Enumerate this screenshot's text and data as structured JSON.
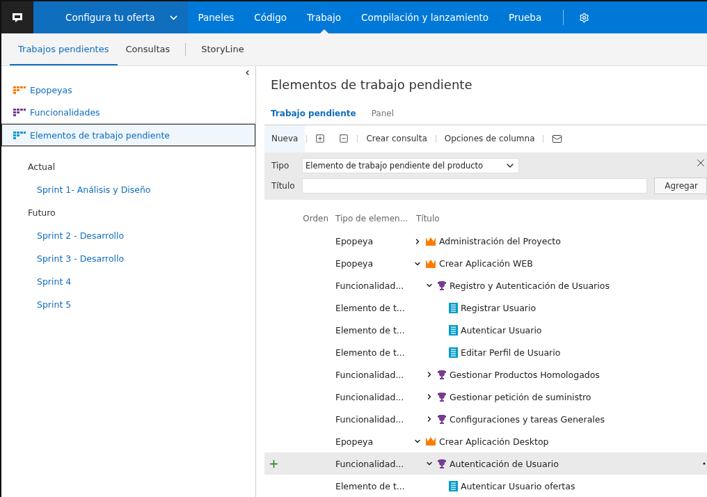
{
  "top_nav": {
    "project": "Configura tu oferta",
    "items": [
      {
        "label": "Paneles",
        "selected": false
      },
      {
        "label": "Código",
        "selected": false
      },
      {
        "label": "Trabajo",
        "selected": true
      },
      {
        "label": "Compilación y lanzamiento",
        "selected": false
      },
      {
        "label": "Prueba",
        "selected": false
      }
    ]
  },
  "sub_nav": {
    "tabs": [
      {
        "label": "Trabajos pendientes",
        "selected": true
      },
      {
        "label": "Consultas",
        "selected": false
      }
    ],
    "extra": "StoryLine"
  },
  "sidebar": {
    "levels": [
      {
        "label": "Epopeyas",
        "color": "#ff7b00",
        "selected": false
      },
      {
        "label": "Funcionalidades",
        "color": "#773b93",
        "selected": false
      },
      {
        "label": "Elementos de trabajo pendiente",
        "color": "#009ccc",
        "selected": true
      }
    ],
    "groups": [
      {
        "label": "Actual",
        "sprints": [
          "Sprint 1- Análisis y Diseño"
        ]
      },
      {
        "label": "Futuro",
        "sprints": [
          "Sprint 2 - Desarrollo",
          "Sprint 3 - Desarrollo",
          "Sprint 4",
          "Sprint 5"
        ]
      }
    ]
  },
  "main": {
    "title": "Elementos de trabajo pendiente",
    "pivots": [
      {
        "label": "Trabajo pendiente",
        "selected": true
      },
      {
        "label": "Panel",
        "selected": false
      }
    ],
    "toolbar": {
      "new": "Nueva",
      "create_query": "Crear consulta",
      "column_options": "Opciones de columna"
    },
    "add_panel": {
      "type_label": "Tipo",
      "type_value": "Elemento de trabajo pendiente del producto",
      "title_label": "Título",
      "add_button": "Agregar"
    },
    "columns": [
      "Orden",
      "Tipo de elemen...",
      "Título"
    ],
    "rows": [
      {
        "type": "Epopeya",
        "kind": "epic",
        "title": "Administración del Proyecto",
        "expanded": false,
        "selected": false
      },
      {
        "type": "Epopeya",
        "kind": "epic",
        "title": "Crear Aplicación WEB",
        "expanded": true,
        "selected": false,
        "children": [
          {
            "type": "Funcionalidad...",
            "kind": "feature",
            "title": "Registro y Autenticación de Usuarios",
            "expanded": true,
            "selected": false,
            "children": [
              {
                "type": "Elemento de t...",
                "kind": "pbi",
                "title": "Registrar Usuario",
                "selected": false
              },
              {
                "type": "Elemento de t...",
                "kind": "pbi",
                "title": "Autenticar Usuario",
                "selected": false
              },
              {
                "type": "Elemento de t...",
                "kind": "pbi",
                "title": "Editar Perfil de Usuario",
                "selected": false
              }
            ]
          },
          {
            "type": "Funcionalidad...",
            "kind": "feature",
            "title": "Gestionar Productos Homologados",
            "expanded": false,
            "selected": false
          },
          {
            "type": "Funcionalidad...",
            "kind": "feature",
            "title": "Gestionar petición de suministro",
            "expanded": false,
            "selected": false
          },
          {
            "type": "Funcionalidad...",
            "kind": "feature",
            "title": "Configuraciones y tareas Generales",
            "expanded": false,
            "selected": false
          }
        ]
      },
      {
        "type": "Epopeya",
        "kind": "epic",
        "title": "Crear Aplicación Desktop",
        "expanded": true,
        "selected": false,
        "children": [
          {
            "type": "Funcionalidad...",
            "kind": "feature",
            "title": "Autenticación de Usuario",
            "expanded": true,
            "selected": true,
            "children": [
              {
                "type": "Elemento de t...",
                "kind": "pbi",
                "title": "Autenticar Usuario ofertas",
                "selected": false
              }
            ]
          }
        ]
      }
    ]
  }
}
